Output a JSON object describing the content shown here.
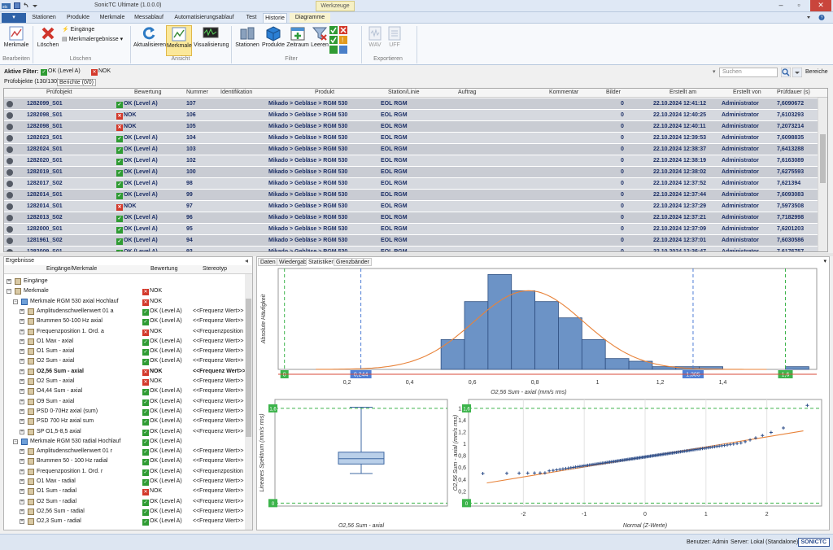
{
  "window": {
    "title": "SonicTC Ultimate (1.0.0.0)",
    "context_tab": "Werkzeuge"
  },
  "ribbon_tabs": [
    "Stationen",
    "Produkte",
    "Merkmale",
    "Messablauf",
    "Automatisierungsablauf",
    "Test",
    "Historie",
    "Diagramme"
  ],
  "ribbon": {
    "bearbeiten": {
      "merkmale": "Merkmale",
      "group": "Bearbeiten"
    },
    "loeschen": {
      "loeschen": "Löschen",
      "eingaenge": "Eingänge",
      "merkmalergebnisse": "Merkmalergebnisse",
      "group": "Löschen"
    },
    "ansicht": {
      "aktualisieren": "Aktualisieren",
      "merkmale": "Merkmale",
      "visualisierung": "Visualisierung",
      "group": "Ansicht"
    },
    "filter": {
      "stationen": "Stationen",
      "produkte": "Produkte",
      "zeitraum": "Zeitraum",
      "leeren": "Leeren",
      "group": "Filter"
    },
    "exportieren": {
      "wav": "WAV",
      "uff": "UFF",
      "group": "Exportieren"
    }
  },
  "filterbar": {
    "label": "Aktive Filter:",
    "ok": "OK (Level A)",
    "nok": "NOK",
    "search_placeholder": "Suchen",
    "bereiche": "Bereiche"
  },
  "subtabs": {
    "pruefobjekte": "Prüfobjekte (130/130)",
    "berichte": "Berichte (0/0)"
  },
  "table": {
    "columns": [
      "Prüfobjekt",
      "Bewertung",
      "Nummer",
      "Identifikation",
      "Produkt",
      "Station/Linie",
      "Auftrag",
      "Kommentar",
      "Bilder",
      "Erstellt am",
      "Erstellt von",
      "Prüfdauer (s)"
    ],
    "rows": [
      [
        "1282099_S01",
        "ok",
        "OK (Level A)",
        "107",
        "Mikado > Gebläse > RGM 530",
        "EOL RGM",
        "0",
        "22.10.2024 12:41:12",
        "Administrator",
        "7,6090672"
      ],
      [
        "1282098_S01",
        "nok",
        "NOK",
        "106",
        "Mikado > Gebläse > RGM 530",
        "EOL RGM",
        "0",
        "22.10.2024 12:40:25",
        "Administrator",
        "7,6103293"
      ],
      [
        "1282098_S01",
        "nok",
        "NOK",
        "105",
        "Mikado > Gebläse > RGM 530",
        "EOL RGM",
        "0",
        "22.10.2024 12:40:11",
        "Administrator",
        "7,2073214"
      ],
      [
        "1282023_S01",
        "ok",
        "OK (Level A)",
        "104",
        "Mikado > Gebläse > RGM 530",
        "EOL RGM",
        "0",
        "22.10.2024 12:39:53",
        "Administrator",
        "7,6098835"
      ],
      [
        "1282024_S01",
        "ok",
        "OK (Level A)",
        "103",
        "Mikado > Gebläse > RGM 530",
        "EOL RGM",
        "0",
        "22.10.2024 12:38:37",
        "Administrator",
        "7,6413288"
      ],
      [
        "1282020_S01",
        "ok",
        "OK (Level A)",
        "102",
        "Mikado > Gebläse > RGM 530",
        "EOL RGM",
        "0",
        "22.10.2024 12:38:19",
        "Administrator",
        "7,6163089"
      ],
      [
        "1282019_S01",
        "ok",
        "OK (Level A)",
        "100",
        "Mikado > Gebläse > RGM 530",
        "EOL RGM",
        "0",
        "22.10.2024 12:38:02",
        "Administrator",
        "7,6275593"
      ],
      [
        "1282017_S02",
        "ok",
        "OK (Level A)",
        "98",
        "Mikado > Gebläse > RGM 530",
        "EOL RGM",
        "0",
        "22.10.2024 12:37:52",
        "Administrator",
        "7,621394"
      ],
      [
        "1282014_S01",
        "ok",
        "OK (Level A)",
        "99",
        "Mikado > Gebläse > RGM 530",
        "EOL RGM",
        "0",
        "22.10.2024 12:37:44",
        "Administrator",
        "7,6093083"
      ],
      [
        "1282014_S01",
        "nok",
        "NOK",
        "97",
        "Mikado > Gebläse > RGM 530",
        "EOL RGM",
        "0",
        "22.10.2024 12:37:29",
        "Administrator",
        "7,5973508"
      ],
      [
        "1282013_S02",
        "ok",
        "OK (Level A)",
        "96",
        "Mikado > Gebläse > RGM 530",
        "EOL RGM",
        "0",
        "22.10.2024 12:37:21",
        "Administrator",
        "7,7182998"
      ],
      [
        "1282000_S01",
        "ok",
        "OK (Level A)",
        "95",
        "Mikado > Gebläse > RGM 530",
        "EOL RGM",
        "0",
        "22.10.2024 12:37:09",
        "Administrator",
        "7,6201203"
      ],
      [
        "1281961_S02",
        "ok",
        "OK (Level A)",
        "94",
        "Mikado > Gebläse > RGM 530",
        "EOL RGM",
        "0",
        "22.10.2024 12:37:01",
        "Administrator",
        "7,6030586"
      ],
      [
        "1282009_S01",
        "ok",
        "OK (Level A)",
        "93",
        "Mikado > Gebläse > RGM 530",
        "EOL RGM",
        "0",
        "22.10.2024 12:36:47",
        "Administrator",
        "7,6176757"
      ]
    ]
  },
  "results": {
    "panel_title": "Ergebnisse",
    "columns": [
      "Eingänge/Merkmale",
      "Bewertung",
      "Stereotyp"
    ],
    "rows": [
      {
        "label": "Eingänge",
        "eval": "",
        "stereo": "",
        "level": 0,
        "icon": "folder"
      },
      {
        "label": "Merkmale",
        "eval": "NOK",
        "status": "nok",
        "stereo": "",
        "level": 0,
        "icon": "folder"
      },
      {
        "label": "Merkmale RGM 530 axial Hochlauf",
        "eval": "NOK",
        "status": "nok",
        "stereo": "",
        "level": 1,
        "icon": "group"
      },
      {
        "label": "Amplitudenschwellenwert 01 a",
        "eval": "OK (Level A)",
        "status": "ok",
        "stereo": "<<Frequenz Wert>>",
        "level": 2
      },
      {
        "label": "Brummen 50-100 Hz axial",
        "eval": "OK (Level A)",
        "status": "ok",
        "stereo": "<<Frequenz Wert>>",
        "level": 2
      },
      {
        "label": "Frequenzposition 1. Ord. a",
        "eval": "NOK",
        "status": "nok",
        "stereo": "<<Frequenzposition",
        "level": 2
      },
      {
        "label": "O1 Max - axial",
        "eval": "OK (Level A)",
        "status": "ok",
        "stereo": "<<Frequenz Wert>>",
        "level": 2
      },
      {
        "label": "O1 Sum - axial",
        "eval": "OK (Level A)",
        "status": "ok",
        "stereo": "<<Frequenz Wert>>",
        "level": 2
      },
      {
        "label": "O2 Sum - axial",
        "eval": "OK (Level A)",
        "status": "ok",
        "stereo": "<<Frequenz Wert>>",
        "level": 2
      },
      {
        "label": "O2,56 Sum - axial",
        "eval": "NOK",
        "status": "nok",
        "stereo": "<<Frequenz Wert>>",
        "level": 2,
        "bold": true
      },
      {
        "label": "O2 Sum - axial",
        "eval": "NOK",
        "status": "nok",
        "stereo": "<<Frequenz Wert>>",
        "level": 2
      },
      {
        "label": "O4,44 Sum - axial",
        "eval": "OK (Level A)",
        "status": "ok",
        "stereo": "<<Frequenz Wert>>",
        "level": 2
      },
      {
        "label": "O9 Sum - axial",
        "eval": "OK (Level A)",
        "status": "ok",
        "stereo": "<<Frequenz Wert>>",
        "level": 2
      },
      {
        "label": "PSD 0-70Hz axial (sum)",
        "eval": "OK (Level A)",
        "status": "ok",
        "stereo": "<<Frequenz Wert>>",
        "level": 2
      },
      {
        "label": "PSD 700 Hz axial sum",
        "eval": "OK (Level A)",
        "status": "ok",
        "stereo": "<<Frequenz Wert>>",
        "level": 2
      },
      {
        "label": "SP O1,5-8,5 axial",
        "eval": "OK (Level A)",
        "status": "ok",
        "stereo": "<<Frequenz Wert>>",
        "level": 2
      },
      {
        "label": "Merkmale RGM 530 radial Hochlauf",
        "eval": "OK (Level A)",
        "status": "ok",
        "stereo": "",
        "level": 1,
        "icon": "group"
      },
      {
        "label": "Amplitudenschwellenwert 01 r",
        "eval": "OK (Level A)",
        "status": "ok",
        "stereo": "<<Frequenz Wert>>",
        "level": 2
      },
      {
        "label": "Brummen 50 - 100 Hz radial",
        "eval": "OK (Level A)",
        "status": "ok",
        "stereo": "<<Frequenz Wert>>",
        "level": 2
      },
      {
        "label": "Frequenzposition 1. Ord. r",
        "eval": "OK (Level A)",
        "status": "ok",
        "stereo": "<<Frequenzposition",
        "level": 2
      },
      {
        "label": "O1 Max - radial",
        "eval": "OK (Level A)",
        "status": "ok",
        "stereo": "<<Frequenz Wert>>",
        "level": 2
      },
      {
        "label": "O1 Sum - radial",
        "eval": "NOK",
        "status": "nok",
        "stereo": "<<Frequenz Wert>>",
        "level": 2
      },
      {
        "label": "O2 Sum - radial",
        "eval": "OK (Level A)",
        "status": "ok",
        "stereo": "<<Frequenz Wert>>",
        "level": 2
      },
      {
        "label": "O2,56 Sum - radial",
        "eval": "OK (Level A)",
        "status": "ok",
        "stereo": "<<Frequenz Wert>>",
        "level": 2
      },
      {
        "label": "O2,3 Sum - radial",
        "eval": "OK (Level A)",
        "status": "ok",
        "stereo": "<<Frequenz Wert>>",
        "level": 2
      }
    ]
  },
  "chart_tabs": [
    "Daten",
    "Wiedergabe",
    "Statistiken",
    "Grenzbänder"
  ],
  "chart_data": [
    {
      "type": "bar",
      "xlabel": "O2,56 Sum - axial (mm/s rms)",
      "ylabel": "Absolute Häufigkeit",
      "bins": [
        {
          "x0": 0.5,
          "x1": 0.575,
          "v": 11
        },
        {
          "x0": 0.575,
          "x1": 0.65,
          "v": 25
        },
        {
          "x0": 0.65,
          "x1": 0.725,
          "v": 35
        },
        {
          "x0": 0.725,
          "x1": 0.8,
          "v": 29
        },
        {
          "x0": 0.8,
          "x1": 0.875,
          "v": 25
        },
        {
          "x0": 0.875,
          "x1": 0.95,
          "v": 19
        },
        {
          "x0": 0.95,
          "x1": 1.025,
          "v": 11
        },
        {
          "x0": 1.025,
          "x1": 1.1,
          "v": 4
        },
        {
          "x0": 1.1,
          "x1": 1.175,
          "v": 3
        },
        {
          "x0": 1.175,
          "x1": 1.25,
          "v": 1
        },
        {
          "x0": 1.25,
          "x1": 1.325,
          "v": 1
        },
        {
          "x0": 1.325,
          "x1": 1.4,
          "v": 1
        },
        {
          "x0": 1.6,
          "x1": 1.675,
          "v": 1
        }
      ],
      "xlim": [
        -0.02,
        1.7
      ],
      "ylim": [
        0,
        36
      ],
      "xticks": [
        "0,2",
        "0,4",
        "0,6",
        "0,8",
        "1",
        "1,2",
        "1,4"
      ],
      "markers": [
        {
          "label": "0",
          "value": 0,
          "color": "#3cb44b"
        },
        {
          "label": "0,244",
          "value": 0.244,
          "color": "#4f7fd6"
        },
        {
          "label": "1,305",
          "value": 1.305,
          "color": "#4f7fd6"
        },
        {
          "label": "1,6",
          "value": 1.6,
          "color": "#3cb44b"
        }
      ],
      "normal_fit": {
        "mean": 0.78,
        "sd": 0.175
      }
    },
    {
      "type": "box",
      "xlabel": "O2,56 Sum - axial",
      "ylabel": "Lineares Spektrum (mm/s rms)",
      "ylim": [
        -0.05,
        1.75
      ],
      "min": 0.5,
      "q1": 0.66,
      "median": 0.75,
      "q3": 0.86,
      "max": 1.62,
      "limits": [
        {
          "label": "1,6",
          "value": 1.6
        },
        {
          "label": "0",
          "value": 0
        }
      ]
    },
    {
      "type": "scatter",
      "xlabel": "Normal (Z-Werte)",
      "ylabel": "O2,56 Sum - axial (mm/s rms)",
      "xlim": [
        -2.9,
        2.9
      ],
      "ylim": [
        -0.05,
        1.75
      ],
      "xticks": [
        -2,
        -1,
        0,
        1,
        2
      ],
      "yticks": [
        "0,2",
        "0,4",
        "0,6",
        "0,8",
        "1",
        "1,2",
        "1,4",
        "1,6"
      ],
      "limits": [
        {
          "label": "1,6",
          "value": 1.6
        },
        {
          "label": "0",
          "value": 0
        }
      ],
      "fit_line": {
        "y_at_min": 0.34,
        "y_at_max": 1.22
      },
      "points": "qq-130"
    }
  ],
  "status": {
    "user": "Benutzer: Admin",
    "server": "Server: Lokal (Standalone)",
    "logo": "SONICTC"
  }
}
